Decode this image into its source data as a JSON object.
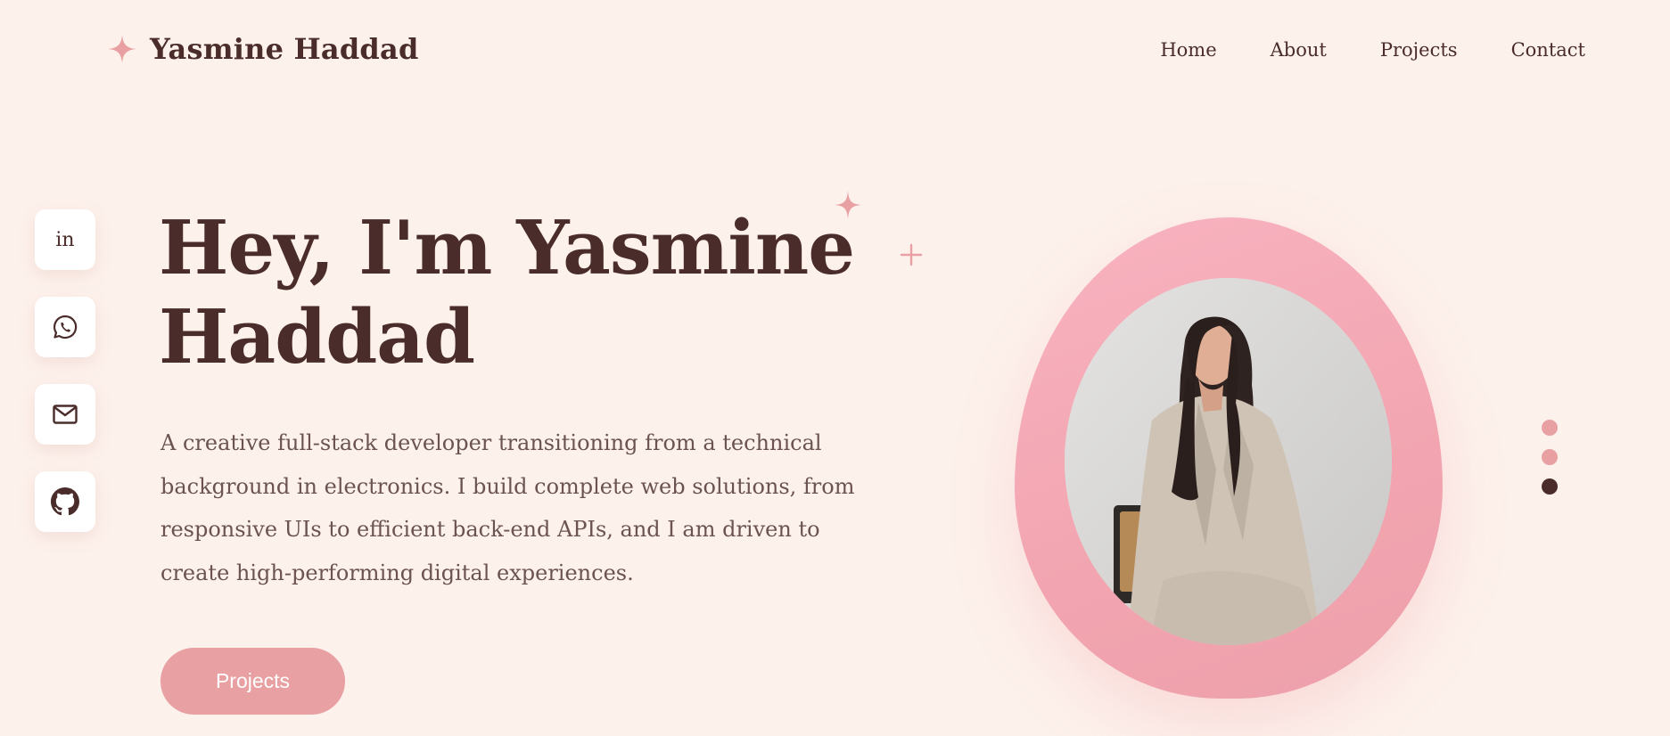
{
  "header": {
    "logo_icon": "sparkle-icon",
    "logo_text": "Yasmine Haddad",
    "nav": [
      {
        "label": "Home"
      },
      {
        "label": "About"
      },
      {
        "label": "Projects"
      },
      {
        "label": "Contact"
      }
    ]
  },
  "social": [
    {
      "icon": "linkedin-icon",
      "text": "in"
    },
    {
      "icon": "whatsapp-icon"
    },
    {
      "icon": "mail-icon"
    },
    {
      "icon": "github-icon"
    }
  ],
  "hero": {
    "title": "Hey, I'm Yasmine Haddad",
    "description": "A creative full-stack developer transitioning from a technical background in electronics. I build complete web solutions, from responsive UIs to efficient back-end APIs, and I am driven to create high-performing digital experiences.",
    "cta_label": "Projects"
  },
  "portrait": {
    "icon": "profile-photo"
  },
  "pagination": {
    "count": 3,
    "active_index": 2
  },
  "colors": {
    "background": "#fdf1ec",
    "primary_text": "#4a2c2a",
    "body_text": "#6a5350",
    "accent": "#e8a0a2",
    "blob": "#f2a5b0"
  }
}
